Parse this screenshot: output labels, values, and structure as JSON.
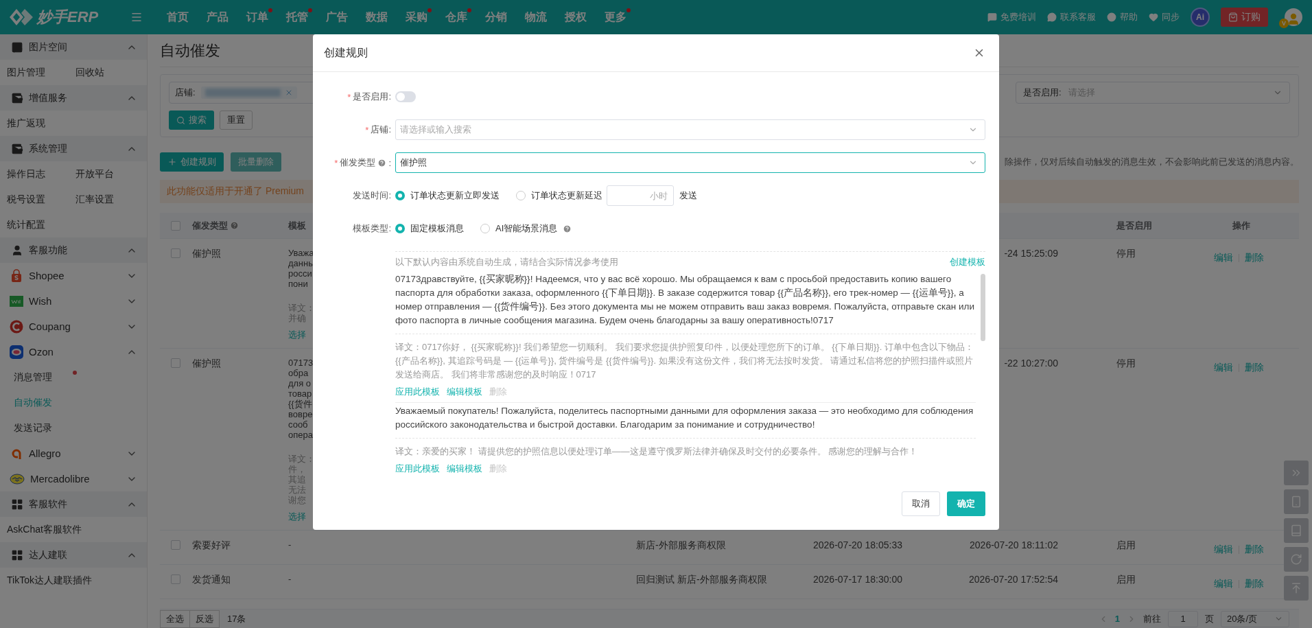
{
  "top_bar": {
    "logo": "妙手ERP",
    "nav": [
      {
        "label": "首页",
        "dot": false
      },
      {
        "label": "产品",
        "dot": false
      },
      {
        "label": "订单",
        "dot": true
      },
      {
        "label": "托管",
        "dot": true
      },
      {
        "label": "广告",
        "dot": false
      },
      {
        "label": "数据",
        "dot": false
      },
      {
        "label": "采购",
        "dot": true
      },
      {
        "label": "仓库",
        "dot": true
      },
      {
        "label": "分销",
        "dot": false
      },
      {
        "label": "物流",
        "dot": false
      },
      {
        "label": "授权",
        "dot": false
      },
      {
        "label": "更多",
        "dot": true
      }
    ],
    "links": [
      {
        "label": "免费培训"
      },
      {
        "label": "联系客服"
      },
      {
        "label": "帮助"
      },
      {
        "label": "同步"
      }
    ],
    "ai_badge": "Ai",
    "order_button": "订购",
    "avatar_badge": "V"
  },
  "sidebar": {
    "sections": [
      {
        "title": "图片空间",
        "expanded": true,
        "items": [
          {
            "label": "图片管理",
            "selected": false
          },
          {
            "label": "回收站",
            "selected": false
          }
        ]
      },
      {
        "title": "增值服务",
        "expanded": true,
        "items": [
          {
            "label": "推广返现",
            "selected": false
          }
        ]
      },
      {
        "title": "系统管理",
        "expanded": true,
        "items": [
          {
            "label": "操作日志",
            "selected": false
          },
          {
            "label": "开放平台",
            "selected": false
          },
          {
            "label": "税号设置",
            "selected": false
          },
          {
            "label": "汇率设置",
            "selected": false
          },
          {
            "label": "统计配置",
            "selected": false
          }
        ]
      },
      {
        "title": "客服功能",
        "expanded": true,
        "platforms": [
          {
            "label": "Shopee",
            "expanded": false
          },
          {
            "label": "Wish",
            "expanded": false
          },
          {
            "label": "Coupang",
            "expanded": false
          },
          {
            "label": "Ozon",
            "expanded": true,
            "items": [
              {
                "label": "消息管理",
                "selected": false,
                "dot": true
              },
              {
                "label": "自动催发",
                "selected": true,
                "dot": false
              },
              {
                "label": "发送记录",
                "selected": false,
                "dot": false
              }
            ]
          },
          {
            "label": "Allegro",
            "expanded": false
          },
          {
            "label": "Mercadolibre",
            "expanded": false
          }
        ]
      },
      {
        "title": "客服软件",
        "expanded": true,
        "items": [
          {
            "label": "AskChat客服软件",
            "selected": false
          }
        ]
      },
      {
        "title": "达人建联",
        "expanded": true,
        "items": [
          {
            "label": "TikTok达人建联插件",
            "selected": false
          }
        ]
      }
    ]
  },
  "page": {
    "title": "自动催发",
    "filter": {
      "store_label": "店铺:",
      "enabled_label": "是否启用:",
      "enabled_placeholder": "请选择",
      "search": "搜索",
      "reset": "重置"
    },
    "toolbar": {
      "create": "创建规则",
      "batch_delete": "批量删除",
      "batch_delete_disabled": true,
      "notice": "除操作，仅对后续自动触发的消息生效，不会影响此前已发送的消息内容。"
    },
    "banner": "此功能仅适用于开通了 Premium",
    "table": {
      "header_checked": false,
      "columns": {
        "type": "催发类型",
        "template": "模板",
        "enabled": "是否启用",
        "actions": "操作"
      },
      "rows": [
        {
          "checked": false,
          "type": "催护照",
          "template_lines": [
            {
              "text": "Уважа",
              "kind": "message"
            },
            {
              "text": "данны",
              "kind": "message"
            },
            {
              "text": "росси",
              "kind": "message"
            },
            {
              "text": "пони",
              "kind": "message"
            },
            {
              "text": "译文：",
              "kind": "translation"
            },
            {
              "text": "并确",
              "kind": "translation"
            },
            {
              "text": "选择",
              "kind": "link"
            }
          ],
          "updated": "-24 15:25:09",
          "enabled": "停用",
          "actions": [
            "编辑",
            "删除"
          ]
        },
        {
          "checked": false,
          "type": "催护照",
          "template_lines": [
            {
              "text": "07173",
              "kind": "message"
            },
            {
              "text": "обра",
              "kind": "message"
            },
            {
              "text": "для о",
              "kind": "message"
            },
            {
              "text": "товар",
              "kind": "message"
            },
            {
              "text": "{{货件",
              "kind": "message"
            },
            {
              "text": "вовре",
              "kind": "message"
            },
            {
              "text": "сооб",
              "kind": "message"
            },
            {
              "text": "опера",
              "kind": "message"
            },
            {
              "text": "译文：",
              "kind": "translation"
            },
            {
              "text": "件，",
              "kind": "translation"
            },
            {
              "text": "其追",
              "kind": "translation"
            },
            {
              "text": "无法",
              "kind": "translation"
            },
            {
              "text": "谢您",
              "kind": "translation"
            },
            {
              "text": "选择",
              "kind": "link"
            }
          ],
          "updated": "-22 10:27:00",
          "enabled": "停用",
          "actions": [
            "编辑",
            "删除"
          ]
        },
        {
          "checked": false,
          "type": "索要好评",
          "template_lines": [
            {
              "text": "-",
              "kind": "message"
            }
          ],
          "store": "新店-外部服务商权限",
          "created": "2026-07-20 18:05:33",
          "updated": "2026-07-20 18:11:02",
          "enabled": "启用",
          "actions": [
            "编辑",
            "删除"
          ]
        },
        {
          "checked": false,
          "type": "发货通知",
          "template_lines": [
            {
              "text": "-",
              "kind": "message"
            }
          ],
          "store": "回归测试 新店-外部服务商权限",
          "created": "2026-07-17 18:30:00",
          "updated": "2026-07-20 17:52:54",
          "enabled": "启用",
          "actions": [
            "编辑",
            "删除"
          ]
        }
      ]
    },
    "footer": {
      "select_all": "全选",
      "invert": "反选",
      "count": "17条",
      "pages": [
        {
          "label": "1",
          "selected": true
        }
      ],
      "goto": "前往",
      "page_input": "1",
      "page_unit": "页",
      "page_size": "20条/页"
    }
  },
  "modal": {
    "title": "创建规则",
    "fields": [
      {
        "kind": "switch",
        "mark": "*",
        "label": "是否启用:",
        "on": false
      },
      {
        "kind": "select",
        "mark": "*",
        "label": "店铺:",
        "placeholder": "请选择或输入搜索",
        "focused": false
      },
      {
        "kind": "select",
        "mark": "*",
        "label": "催发类型",
        "help": true,
        "label_suffix": ":",
        "value": "催护照",
        "focused": true
      },
      {
        "kind": "radio",
        "label": "发送时间:",
        "options": [
          {
            "label": "订单状态更新立即发送",
            "selected": true
          },
          {
            "label": "订单状态更新延迟",
            "selected": false,
            "input_placeholder": "小时",
            "suffix": "发送"
          }
        ]
      },
      {
        "kind": "radio",
        "label": "模板类型:",
        "options": [
          {
            "label": "固定模板消息",
            "selected": true
          },
          {
            "label": "AI智能场景消息",
            "selected": false,
            "help": true
          }
        ]
      }
    ],
    "templates": {
      "hint": "以下默认内容由系统自动生成，请结合实际情况参考使用",
      "create_link": "创建模板",
      "items": [
        {
          "text": "07173дравствуйте, {{买家昵称}}! Надеемся, что у вас всё хорошо. Мы обращаемся к вам с просьбой предоставить копию вашего паспорта для обработки заказа, оформленного {{下单日期}}. В заказе содержится товар {{产品名称}}, его трек-номер — {{运单号}}, а номер отправления — {{货件编号}}. Без этого документа мы не можем отправить ваш заказ вовремя. Пожалуйста, отправьте скан или фото паспорта в личные сообщения магазина. Будем очень благодарны за вашу оперативность!0717",
          "translation": "译文：0717你好， {{买家昵称}}! 我们希望您一切顺利。 我们要求您提供护照复印件，以便处理您所下的订单。 {{下单日期}}. 订单中包含以下物品：{{产品名称}}, 其追踪号码是 — {{运单号}}, 货件编号是 {{货件编号}}. 如果没有这份文件，我们将无法按时发货。 请通过私信将您的护照扫描件或照片发送给商店。 我们将非常感谢您的及时响应！0717",
          "actions": [
            {
              "label": "应用此模板",
              "disabled": false
            },
            {
              "label": "编辑模板",
              "disabled": false
            },
            {
              "label": "删除",
              "disabled": true
            }
          ]
        },
        {
          "text": "Уважаемый покупатель! Пожалуйста, поделитесь паспортными данными для оформления заказа — это необходимо для соблюдения российского законодательства и быстрой доставки. Благодарим за понимание и сотрудничество!",
          "translation": "译文：亲爱的买家！ 请提供您的护照信息以便处理订单——这是遵守俄罗斯法律并确保及时交付的必要条件。 感谢您的理解与合作！",
          "actions": [
            {
              "label": "应用此模板",
              "disabled": false
            },
            {
              "label": "编辑模板",
              "disabled": false
            },
            {
              "label": "删除",
              "disabled": true
            }
          ]
        }
      ]
    },
    "cancel": "取消",
    "confirm": "确定"
  }
}
